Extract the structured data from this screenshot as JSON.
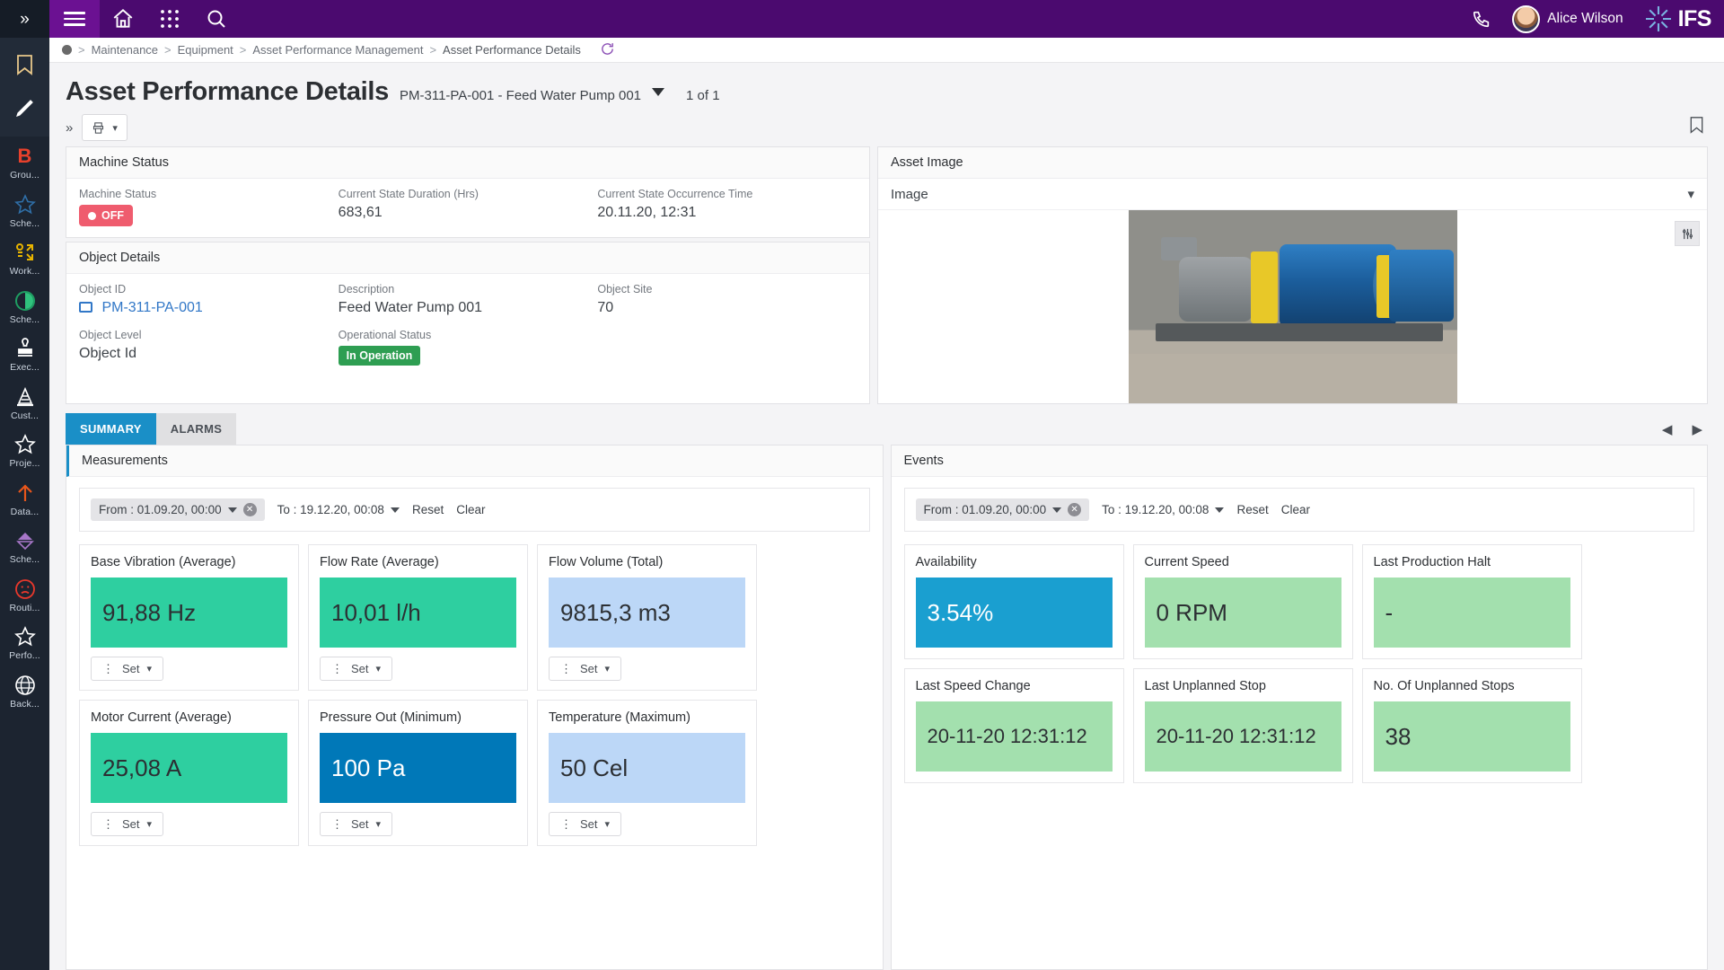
{
  "rail": {
    "collapse_icon": "chevron-double-right-icon",
    "fixed": [
      {
        "name": "bookmark-icon"
      },
      {
        "name": "pencil-icon"
      }
    ],
    "items": [
      {
        "icon": "b-letter-icon",
        "label": "Grou..."
      },
      {
        "icon": "star-outline-icon",
        "label": "Sche..."
      },
      {
        "icon": "workflow-icon",
        "label": "Work..."
      },
      {
        "icon": "pie-chart-icon",
        "label": "Sche..."
      },
      {
        "icon": "stamp-icon",
        "label": "Exec..."
      },
      {
        "icon": "traffic-cone-icon",
        "label": "Cust..."
      },
      {
        "icon": "star-outline-icon",
        "label": "Proje..."
      },
      {
        "icon": "arrow-up-icon",
        "label": "Data..."
      },
      {
        "icon": "diamond-sort-icon",
        "label": "Sche..."
      },
      {
        "icon": "sad-face-icon",
        "label": "Routi..."
      },
      {
        "icon": "star-outline-icon",
        "label": "Perfo..."
      },
      {
        "icon": "globe-icon",
        "label": "Back..."
      }
    ]
  },
  "topbar": {
    "menu_icon": "hamburger-menu-icon",
    "home_icon": "home-icon",
    "apps_icon": "apps-grid-icon",
    "search_icon": "search-icon",
    "phone_icon": "phone-icon",
    "user_name": "Alice Wilson",
    "brand": "IFS"
  },
  "breadcrumb": {
    "items": [
      "Maintenance",
      "Equipment",
      "Asset Performance Management",
      "Asset Performance Details"
    ],
    "separator": ">",
    "refresh_icon": "refresh-icon"
  },
  "header": {
    "title": "Asset Performance Details",
    "subtitle": "PM-311-PA-001 - Feed Water Pump 001",
    "record_count": "1 of 1"
  },
  "commandbar": {
    "expand_icon": "chevron-double-right-icon",
    "print_icon": "print-preview-icon",
    "bookmark_icon": "bookmark-outline-icon"
  },
  "machine_status": {
    "title": "Machine Status",
    "fields": [
      {
        "label": "Machine Status",
        "value": "OFF"
      },
      {
        "label": "Current State Duration (Hrs)",
        "value": "683,61"
      },
      {
        "label": "Current State Occurrence Time",
        "value": "20.11.20, 12:31"
      }
    ]
  },
  "object_details": {
    "title": "Object Details",
    "row1": [
      {
        "label": "Object ID",
        "value": "PM-311-PA-001"
      },
      {
        "label": "Description",
        "value": "Feed Water Pump 001"
      },
      {
        "label": "Object Site",
        "value": "70"
      }
    ],
    "row2": [
      {
        "label": "Object Level",
        "value": "Object Id"
      },
      {
        "label": "Operational Status",
        "value": "In Operation"
      }
    ]
  },
  "asset_image": {
    "title": "Asset Image",
    "selector_label": "Image",
    "tools_icon": "sliders-icon",
    "image_alt": "blue-pump-motor-photo"
  },
  "tabs": [
    {
      "label": "SUMMARY",
      "active": true
    },
    {
      "label": "ALARMS",
      "active": false
    }
  ],
  "tab_nav": {
    "prev_icon": "chevron-left-icon",
    "next_icon": "chevron-right-icon"
  },
  "measurements": {
    "title": "Measurements",
    "filter": {
      "from": "From : 01.09.20, 00:00",
      "to": "To : 19.12.20, 00:08",
      "reset": "Reset",
      "clear": "Clear"
    },
    "set_label": "Set",
    "tiles": [
      {
        "title": "Base Vibration (Average)",
        "value": "91,88 Hz",
        "bg": "#2ecfa0",
        "fg": "#2c2f33",
        "has_set": true
      },
      {
        "title": "Flow Rate (Average)",
        "value": "10,01 l/h",
        "bg": "#2ecfa0",
        "fg": "#2c2f33",
        "has_set": true
      },
      {
        "title": "Flow Volume (Total)",
        "value": "9815,3 m3",
        "bg": "#bcd7f7",
        "fg": "#2c2f33",
        "has_set": true
      },
      {
        "title": "Motor Current (Average)",
        "value": "25,08 A",
        "bg": "#2ecfa0",
        "fg": "#2c2f33",
        "has_set": true
      },
      {
        "title": "Pressure Out (Minimum)",
        "value": "100 Pa",
        "bg": "#0078b8",
        "fg": "#ffffff",
        "has_set": true
      },
      {
        "title": "Temperature (Maximum)",
        "value": "50 Cel",
        "bg": "#bcd7f7",
        "fg": "#2c2f33",
        "has_set": true
      }
    ]
  },
  "events": {
    "title": "Events",
    "filter": {
      "from": "From : 01.09.20, 00:00",
      "to": "To : 19.12.20, 00:08",
      "reset": "Reset",
      "clear": "Clear"
    },
    "tiles": [
      {
        "title": "Availability",
        "value": "3.54%",
        "bg": "#1a9fd0",
        "fg": "#ffffff"
      },
      {
        "title": "Current Speed",
        "value": "0 RPM",
        "bg": "#a3e0ae",
        "fg": "#2c2f33"
      },
      {
        "title": "Last Production Halt",
        "value": "-",
        "bg": "#a3e0ae",
        "fg": "#2c2f33"
      },
      {
        "title": "Last Speed Change",
        "value": "20-11-20 12:31:12",
        "bg": "#a3e0ae",
        "fg": "#2c2f33"
      },
      {
        "title": "Last Unplanned Stop",
        "value": "20-11-20 12:31:12",
        "bg": "#a3e0ae",
        "fg": "#2c2f33"
      },
      {
        "title": "No. Of Unplanned Stops",
        "value": "38",
        "bg": "#a3e0ae",
        "fg": "#2c2f33"
      }
    ]
  },
  "colors": {
    "brand_purple": "#4b0a6f",
    "accent_blue": "#1a8fc7",
    "status_off_red": "#ef5c6e",
    "status_green": "#2e9e52"
  }
}
